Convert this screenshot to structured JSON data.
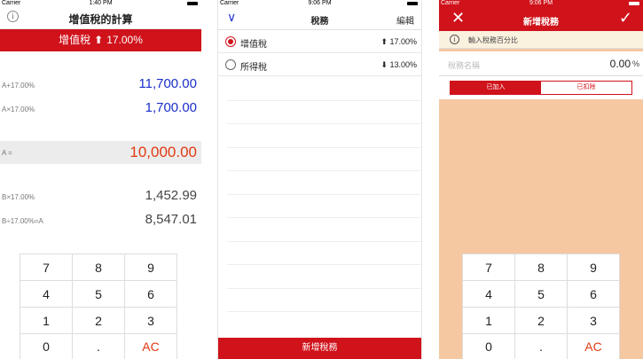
{
  "screen1": {
    "status": {
      "carrier": "Carrier",
      "time": "1:40 PM"
    },
    "nav": {
      "info_icon": "info-icon",
      "title": "增值稅的計算"
    },
    "rate_bar": {
      "label": "增值稅",
      "arrow": "⬆",
      "rate": "17.00%"
    },
    "rows": [
      {
        "label": "A+17.00%",
        "value": "11,700.00",
        "color": "blue"
      },
      {
        "label": "A×17.00%",
        "value": "1,700.00",
        "color": "blue"
      },
      {
        "label": "A =",
        "value": "10,000.00",
        "color": "red"
      },
      {
        "label": "B×17.00%",
        "value": "1,452.99",
        "color": "gray"
      },
      {
        "label": "B÷17.00%=A",
        "value": "8,547.01",
        "color": "gray"
      }
    ],
    "keypad": [
      "7",
      "8",
      "9",
      "4",
      "5",
      "6",
      "1",
      "2",
      "3",
      "0",
      ".",
      "AC"
    ]
  },
  "screen2": {
    "status": {
      "carrier": "Carrier",
      "time": "9:06 PM"
    },
    "nav": {
      "back_icon": "chevron-down-icon",
      "title": "稅務",
      "edit": "編輯"
    },
    "taxes": [
      {
        "name": "增值稅",
        "rate": "⬆ 17.00%",
        "selected": true
      },
      {
        "name": "所得稅",
        "rate": "⬇ 13.00%",
        "selected": false
      }
    ],
    "add_button": "新增稅務"
  },
  "screen3": {
    "status": {
      "carrier": "Carrier",
      "time": "9:06 PM"
    },
    "nav": {
      "close": "✕",
      "title": "新增稅務",
      "check": "✓"
    },
    "hint": "輸入稅務百分比",
    "name_placeholder": "稅務名稱",
    "percent_value": "0.00",
    "percent_unit": "%",
    "segments": [
      "已加入",
      "已扣除"
    ],
    "keypad": [
      "7",
      "8",
      "9",
      "4",
      "5",
      "6",
      "1",
      "2",
      "3",
      "0",
      ".",
      "AC"
    ]
  },
  "colors": {
    "accent": "#d0121b",
    "blue_value": "#1a2fc9",
    "red_value": "#e03a12",
    "form_bg": "#f5c8a2"
  }
}
